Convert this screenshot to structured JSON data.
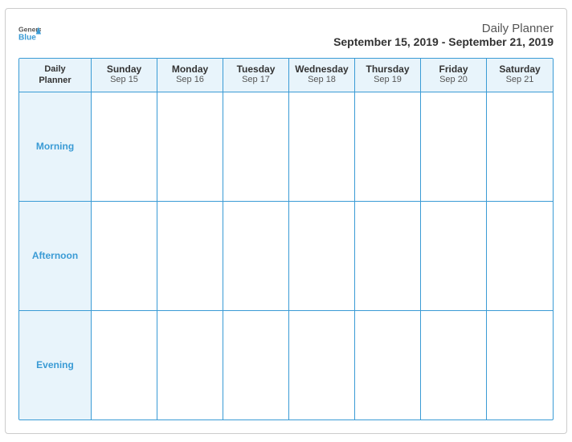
{
  "logo": {
    "general": "General",
    "blue": "Blue"
  },
  "header": {
    "title": "Daily Planner",
    "date_range": "September 15, 2019 - September 21, 2019"
  },
  "calendar": {
    "label": {
      "line1": "Daily",
      "line2": "Planner"
    },
    "columns": [
      {
        "day": "Sunday",
        "date": "Sep 15"
      },
      {
        "day": "Monday",
        "date": "Sep 16"
      },
      {
        "day": "Tuesday",
        "date": "Sep 17"
      },
      {
        "day": "Wednesday",
        "date": "Sep 18"
      },
      {
        "day": "Thursday",
        "date": "Sep 19"
      },
      {
        "day": "Friday",
        "date": "Sep 20"
      },
      {
        "day": "Saturday",
        "date": "Sep 21"
      }
    ],
    "rows": [
      {
        "label": "Morning"
      },
      {
        "label": "Afternoon"
      },
      {
        "label": "Evening"
      }
    ]
  }
}
